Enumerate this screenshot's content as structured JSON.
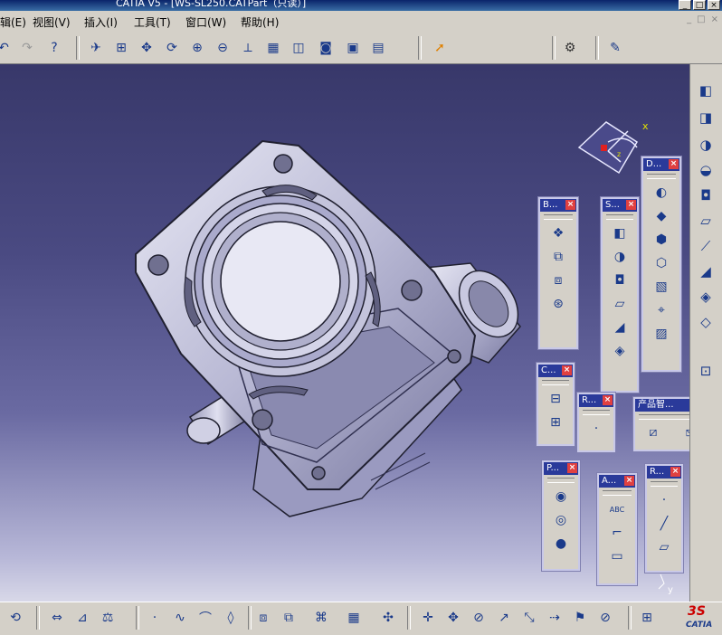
{
  "window": {
    "title": "CATIA V5 - [WS-SL250.CATPart（只读）]",
    "buttons": [
      "_",
      "□",
      "×"
    ]
  },
  "menu": {
    "items": [
      "辑(E)",
      "视图(V)",
      "插入(I)",
      "工具(T)",
      "窗口(W)",
      "帮助(H)"
    ],
    "mdi_buttons": [
      "_",
      "□",
      "×"
    ]
  },
  "panels": [
    {
      "id": "b",
      "title": "B...",
      "close": "×"
    },
    {
      "id": "s",
      "title": "S...",
      "close": "×"
    },
    {
      "id": "d",
      "title": "D...",
      "close": "×"
    },
    {
      "id": "c",
      "title": "C...",
      "close": "×"
    },
    {
      "id": "r1",
      "title": "R...",
      "close": "×"
    },
    {
      "id": "pz",
      "title": "产品智...",
      "close": "×"
    },
    {
      "id": "p",
      "title": "P...",
      "close": "×"
    },
    {
      "id": "a",
      "title": "A...",
      "close": "×"
    },
    {
      "id": "r2",
      "title": "R...",
      "close": "×"
    }
  ],
  "compass": {
    "x_label": "x",
    "z_label": "z"
  },
  "axis_y_label": "y",
  "logo": {
    "brand": "3S",
    "product": "CATIA"
  },
  "annotation_abc": "ABC",
  "icons": {
    "top": [
      "undo-icon",
      "redo-icon",
      "whats-this-icon",
      "fly-icon",
      "fit-all-icon",
      "pan-icon",
      "rotate-icon",
      "zoom-in-icon",
      "zoom-out-icon",
      "normal-view-icon",
      "multi-view-icon",
      "iso-view-icon",
      "shading-icon",
      "hide-show-icon",
      "swap-visible-icon",
      "select-arrow-icon",
      "settings-gear-icon",
      "sketch-icon"
    ],
    "right": [
      "pad-icon",
      "pocket-icon",
      "shaft-icon",
      "groove-icon",
      "hole-icon",
      "rib-icon",
      "slot-icon",
      "stiffener-icon",
      "loft-icon",
      "remove-loft-icon",
      "measure-icon"
    ],
    "bottom": [
      "update-icon",
      "measure-between-icon",
      "measure-item-icon",
      "mass-icon",
      "point-icon",
      "spline-icon",
      "curve-icon",
      "plane-icon",
      "boolean-icon",
      "boolean2-icon",
      "axis-system-icon",
      "grid-icon",
      "snap-icon",
      "compass-icon",
      "manipulate-icon",
      "no-show-icon",
      "translate-icon",
      "symmetry-icon",
      "scale-icon",
      "flag-icon",
      "constraint-icon",
      "catalog-icon"
    ]
  }
}
